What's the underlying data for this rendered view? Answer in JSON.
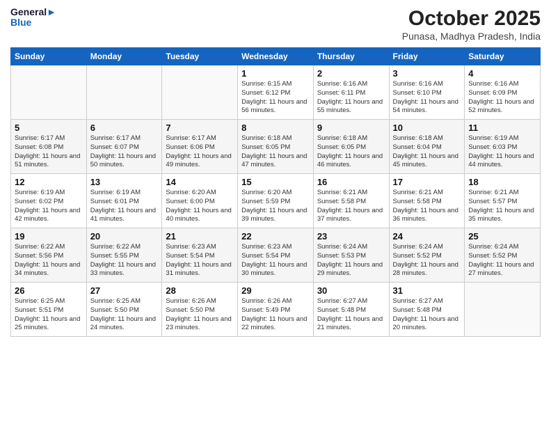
{
  "header": {
    "logo_general": "General",
    "logo_blue": "Blue",
    "month_title": "October 2025",
    "location": "Punasa, Madhya Pradesh, India"
  },
  "weekdays": [
    "Sunday",
    "Monday",
    "Tuesday",
    "Wednesday",
    "Thursday",
    "Friday",
    "Saturday"
  ],
  "weeks": [
    [
      {
        "day": "",
        "sunrise": "",
        "sunset": "",
        "daylight": ""
      },
      {
        "day": "",
        "sunrise": "",
        "sunset": "",
        "daylight": ""
      },
      {
        "day": "",
        "sunrise": "",
        "sunset": "",
        "daylight": ""
      },
      {
        "day": "1",
        "sunrise": "Sunrise: 6:15 AM",
        "sunset": "Sunset: 6:12 PM",
        "daylight": "Daylight: 11 hours and 56 minutes."
      },
      {
        "day": "2",
        "sunrise": "Sunrise: 6:16 AM",
        "sunset": "Sunset: 6:11 PM",
        "daylight": "Daylight: 11 hours and 55 minutes."
      },
      {
        "day": "3",
        "sunrise": "Sunrise: 6:16 AM",
        "sunset": "Sunset: 6:10 PM",
        "daylight": "Daylight: 11 hours and 54 minutes."
      },
      {
        "day": "4",
        "sunrise": "Sunrise: 6:16 AM",
        "sunset": "Sunset: 6:09 PM",
        "daylight": "Daylight: 11 hours and 52 minutes."
      }
    ],
    [
      {
        "day": "5",
        "sunrise": "Sunrise: 6:17 AM",
        "sunset": "Sunset: 6:08 PM",
        "daylight": "Daylight: 11 hours and 51 minutes."
      },
      {
        "day": "6",
        "sunrise": "Sunrise: 6:17 AM",
        "sunset": "Sunset: 6:07 PM",
        "daylight": "Daylight: 11 hours and 50 minutes."
      },
      {
        "day": "7",
        "sunrise": "Sunrise: 6:17 AM",
        "sunset": "Sunset: 6:06 PM",
        "daylight": "Daylight: 11 hours and 49 minutes."
      },
      {
        "day": "8",
        "sunrise": "Sunrise: 6:18 AM",
        "sunset": "Sunset: 6:05 PM",
        "daylight": "Daylight: 11 hours and 47 minutes."
      },
      {
        "day": "9",
        "sunrise": "Sunrise: 6:18 AM",
        "sunset": "Sunset: 6:05 PM",
        "daylight": "Daylight: 11 hours and 46 minutes."
      },
      {
        "day": "10",
        "sunrise": "Sunrise: 6:18 AM",
        "sunset": "Sunset: 6:04 PM",
        "daylight": "Daylight: 11 hours and 45 minutes."
      },
      {
        "day": "11",
        "sunrise": "Sunrise: 6:19 AM",
        "sunset": "Sunset: 6:03 PM",
        "daylight": "Daylight: 11 hours and 44 minutes."
      }
    ],
    [
      {
        "day": "12",
        "sunrise": "Sunrise: 6:19 AM",
        "sunset": "Sunset: 6:02 PM",
        "daylight": "Daylight: 11 hours and 42 minutes."
      },
      {
        "day": "13",
        "sunrise": "Sunrise: 6:19 AM",
        "sunset": "Sunset: 6:01 PM",
        "daylight": "Daylight: 11 hours and 41 minutes."
      },
      {
        "day": "14",
        "sunrise": "Sunrise: 6:20 AM",
        "sunset": "Sunset: 6:00 PM",
        "daylight": "Daylight: 11 hours and 40 minutes."
      },
      {
        "day": "15",
        "sunrise": "Sunrise: 6:20 AM",
        "sunset": "Sunset: 5:59 PM",
        "daylight": "Daylight: 11 hours and 39 minutes."
      },
      {
        "day": "16",
        "sunrise": "Sunrise: 6:21 AM",
        "sunset": "Sunset: 5:58 PM",
        "daylight": "Daylight: 11 hours and 37 minutes."
      },
      {
        "day": "17",
        "sunrise": "Sunrise: 6:21 AM",
        "sunset": "Sunset: 5:58 PM",
        "daylight": "Daylight: 11 hours and 36 minutes."
      },
      {
        "day": "18",
        "sunrise": "Sunrise: 6:21 AM",
        "sunset": "Sunset: 5:57 PM",
        "daylight": "Daylight: 11 hours and 35 minutes."
      }
    ],
    [
      {
        "day": "19",
        "sunrise": "Sunrise: 6:22 AM",
        "sunset": "Sunset: 5:56 PM",
        "daylight": "Daylight: 11 hours and 34 minutes."
      },
      {
        "day": "20",
        "sunrise": "Sunrise: 6:22 AM",
        "sunset": "Sunset: 5:55 PM",
        "daylight": "Daylight: 11 hours and 33 minutes."
      },
      {
        "day": "21",
        "sunrise": "Sunrise: 6:23 AM",
        "sunset": "Sunset: 5:54 PM",
        "daylight": "Daylight: 11 hours and 31 minutes."
      },
      {
        "day": "22",
        "sunrise": "Sunrise: 6:23 AM",
        "sunset": "Sunset: 5:54 PM",
        "daylight": "Daylight: 11 hours and 30 minutes."
      },
      {
        "day": "23",
        "sunrise": "Sunrise: 6:24 AM",
        "sunset": "Sunset: 5:53 PM",
        "daylight": "Daylight: 11 hours and 29 minutes."
      },
      {
        "day": "24",
        "sunrise": "Sunrise: 6:24 AM",
        "sunset": "Sunset: 5:52 PM",
        "daylight": "Daylight: 11 hours and 28 minutes."
      },
      {
        "day": "25",
        "sunrise": "Sunrise: 6:24 AM",
        "sunset": "Sunset: 5:52 PM",
        "daylight": "Daylight: 11 hours and 27 minutes."
      }
    ],
    [
      {
        "day": "26",
        "sunrise": "Sunrise: 6:25 AM",
        "sunset": "Sunset: 5:51 PM",
        "daylight": "Daylight: 11 hours and 25 minutes."
      },
      {
        "day": "27",
        "sunrise": "Sunrise: 6:25 AM",
        "sunset": "Sunset: 5:50 PM",
        "daylight": "Daylight: 11 hours and 24 minutes."
      },
      {
        "day": "28",
        "sunrise": "Sunrise: 6:26 AM",
        "sunset": "Sunset: 5:50 PM",
        "daylight": "Daylight: 11 hours and 23 minutes."
      },
      {
        "day": "29",
        "sunrise": "Sunrise: 6:26 AM",
        "sunset": "Sunset: 5:49 PM",
        "daylight": "Daylight: 11 hours and 22 minutes."
      },
      {
        "day": "30",
        "sunrise": "Sunrise: 6:27 AM",
        "sunset": "Sunset: 5:48 PM",
        "daylight": "Daylight: 11 hours and 21 minutes."
      },
      {
        "day": "31",
        "sunrise": "Sunrise: 6:27 AM",
        "sunset": "Sunset: 5:48 PM",
        "daylight": "Daylight: 11 hours and 20 minutes."
      },
      {
        "day": "",
        "sunrise": "",
        "sunset": "",
        "daylight": ""
      }
    ]
  ]
}
